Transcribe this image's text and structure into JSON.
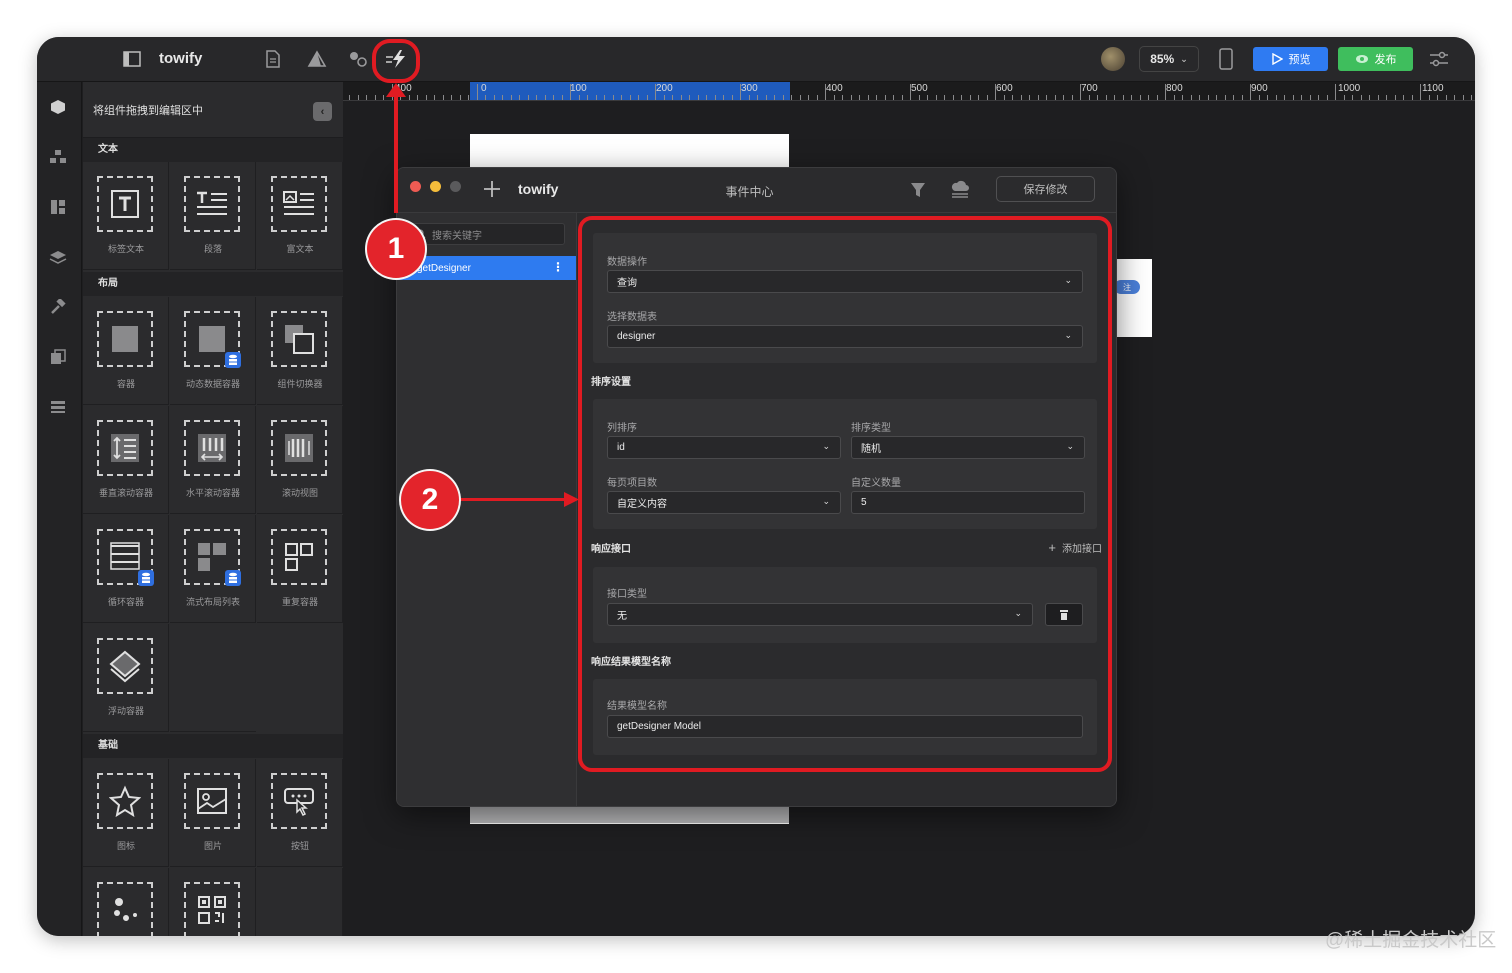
{
  "toolbar": {
    "app_name": "towify",
    "zoom": "85%",
    "preview_label": "预览",
    "publish_label": "发布",
    "colors": {
      "preview": "#2f7bf2",
      "publish": "#3fbe5d"
    }
  },
  "component_panel": {
    "hint": "将组件拖拽到编辑区中",
    "sections": [
      {
        "title": "文本",
        "items": [
          "标签文本",
          "段落",
          "富文本"
        ]
      },
      {
        "title": "布局",
        "items": [
          "容器",
          "动态数据容器",
          "组件切换器",
          "垂直滚动容器",
          "水平滚动容器",
          "滚动视图",
          "循环容器",
          "流式布局列表",
          "重复容器",
          "浮动容器"
        ]
      },
      {
        "title": "基础",
        "items": [
          "图标",
          "图片",
          "按钮"
        ]
      }
    ]
  },
  "ruler": {
    "labels": [
      "400",
      "0",
      "100",
      "200",
      "300",
      "400",
      "500",
      "600",
      "700",
      "800",
      "900",
      "1000",
      "1100"
    ]
  },
  "canvas": {
    "pill_text": "注"
  },
  "event_center": {
    "title": "towify",
    "center_label": "事件中心",
    "save_label": "保存修改",
    "search_placeholder": "搜索关键字",
    "selected_item": "getDesigner",
    "data_operation": {
      "label": "数据操作",
      "value": "查询"
    },
    "data_table": {
      "label": "选择数据表",
      "value": "designer"
    },
    "sort_section": "排序设置",
    "column_sort": {
      "label": "列排序",
      "value": "id"
    },
    "sort_type": {
      "label": "排序类型",
      "value": "随机"
    },
    "page_size": {
      "label": "每页项目数",
      "value": "自定义内容"
    },
    "custom_count": {
      "label": "自定义数量",
      "value": "5"
    },
    "response_section": "响应接口",
    "add_interface": "添加接口",
    "interface_type": {
      "label": "接口类型",
      "value": "无"
    },
    "result_model_section": "响应结果模型名称",
    "result_model": {
      "label": "结果模型名称",
      "value": "getDesigner Model"
    }
  },
  "annotations": {
    "badge_1": "1",
    "badge_2": "2",
    "color": "#e01b22"
  },
  "watermark": "@稀土掘金技术社区"
}
